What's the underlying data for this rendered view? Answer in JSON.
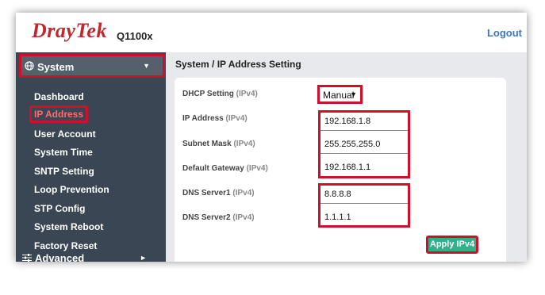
{
  "header": {
    "logo": "DrayTek",
    "model": "Q1100x",
    "logout_label": "Logout"
  },
  "sidebar": {
    "system_label": "System",
    "advanced_label": "Advanced",
    "items": [
      {
        "label": "Dashboard"
      },
      {
        "label": "IP Address"
      },
      {
        "label": "User Account"
      },
      {
        "label": "System Time"
      },
      {
        "label": "SNTP Setting"
      },
      {
        "label": "Loop Prevention"
      },
      {
        "label": "STP Config"
      },
      {
        "label": "System Reboot"
      },
      {
        "label": "Factory Reset"
      }
    ]
  },
  "main": {
    "title": "System / IP Address Setting",
    "fields": {
      "dhcp": {
        "label": "DHCP Setting",
        "sub": "(IPv4)",
        "value": "Manual"
      },
      "ip": {
        "label": "IP Address",
        "sub": "(IPv4)",
        "value": "192.168.1.8"
      },
      "mask": {
        "label": "Subnet Mask",
        "sub": "(IPv4)",
        "value": "255.255.255.0"
      },
      "gateway": {
        "label": "Default Gateway",
        "sub": "(IPv4)",
        "value": "192.168.1.1"
      },
      "dns1": {
        "label": "DNS Server1",
        "sub": "(IPv4)",
        "value": "8.8.8.8"
      },
      "dns2": {
        "label": "DNS Server2",
        "sub": "(IPv4)",
        "value": "1.1.1.1"
      }
    },
    "apply_label": "Apply IPv4"
  },
  "colors": {
    "brand_red": "#c0282e",
    "highlight_red": "#d0102b",
    "sidebar_bg": "#3a4653",
    "apply_green": "#2fb28a",
    "logout_blue": "#3a78c6"
  }
}
